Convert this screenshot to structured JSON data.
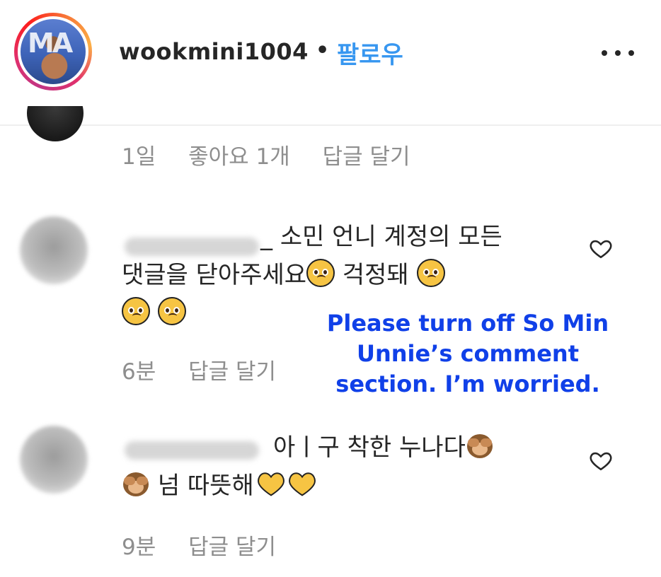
{
  "header": {
    "username": "wookmini1004",
    "separator": "•",
    "follow_label": "팔로우",
    "avatar_logo_text": "MA"
  },
  "previous_comment": {
    "time": "1일",
    "likes": "좋아요 1개",
    "reply": "답글 달기"
  },
  "comments": [
    {
      "username_suffix": "_",
      "line1": "소민 언니 계정의 모든",
      "line2_text": "댓글을 닫아주세요",
      "line2_after": "걱정돼",
      "time": "6분",
      "reply": "답글 달기"
    },
    {
      "line1": "아ㅣ구 착한 누나다",
      "line2_text": "넘 따뜻해",
      "time": "9분",
      "reply": "답글 달기"
    }
  ],
  "caption": {
    "line1": "Please turn off So Min",
    "line2": "Unnie’s comment",
    "line3": "section. I’m worried."
  },
  "colors": {
    "follow": "#3897f0",
    "caption": "#1040e8",
    "meta": "#8e8e8e",
    "heart_emoji": "#f6c443"
  },
  "icons": [
    "more-icon",
    "heart-icon",
    "pleading-face-emoji",
    "see-no-evil-monkey-emoji",
    "yellow-heart-emoji"
  ]
}
